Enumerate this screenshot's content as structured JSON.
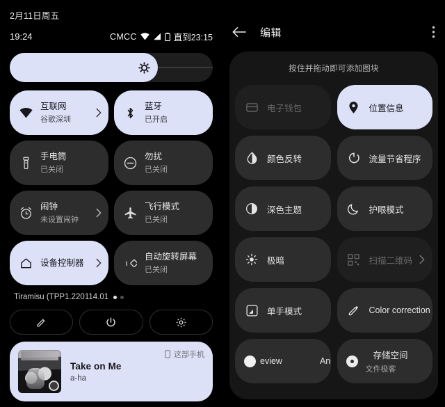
{
  "left_panel": {
    "date": "2月11日周五",
    "status": {
      "clock": "19:24",
      "carrier": "CMCC",
      "wifi_icon": "wifi-icon",
      "signal_icon": "cellular-signal-icon",
      "battery_icon": "battery-icon",
      "battery_text": "直到23:15"
    },
    "brightness": {
      "icon": "brightness-icon",
      "level_percent": 73
    },
    "tiles": [
      {
        "title": "互联网",
        "subtitle": "谷歌深圳",
        "icon": "wifi-icon",
        "active": true,
        "chevron": true
      },
      {
        "title": "蓝牙",
        "subtitle": "已开启",
        "icon": "bluetooth-icon",
        "active": true,
        "chevron": false
      },
      {
        "title": "手电筒",
        "subtitle": "已关闭",
        "icon": "flashlight-icon",
        "active": false,
        "chevron": false
      },
      {
        "title": "勿扰",
        "subtitle": "已关闭",
        "icon": "do-not-disturb-icon",
        "active": false,
        "chevron": false
      },
      {
        "title": "闹钟",
        "subtitle": "未设置闹钟",
        "icon": "alarm-icon",
        "active": false,
        "chevron": true
      },
      {
        "title": "飞行模式",
        "subtitle": "已关闭",
        "icon": "airplane-icon",
        "active": false,
        "chevron": false
      },
      {
        "title": "设备控制器",
        "subtitle": "",
        "icon": "home-icon",
        "active": true,
        "chevron": true
      },
      {
        "title": "自动旋转屏幕",
        "subtitle": "已关闭",
        "icon": "auto-rotate-icon",
        "active": false,
        "chevron": false
      }
    ],
    "build": "Tiramisu (TPP1.220114.01",
    "pager": {
      "pages": 2,
      "current": 1
    },
    "actions": [
      {
        "name": "edit-button",
        "icon": "pencil-icon"
      },
      {
        "name": "power-button",
        "icon": "power-icon"
      },
      {
        "name": "settings-button",
        "icon": "gear-icon"
      }
    ],
    "media": {
      "title": "Take on Me",
      "artist": "a-ha",
      "device": "这部手机",
      "device_icon": "phone-icon",
      "album_art": "album-art"
    }
  },
  "right_panel": {
    "header": {
      "back_icon": "back-arrow-icon",
      "title": "编辑",
      "overflow_icon": "overflow-menu-icon"
    },
    "hint": "按住并拖动即可添加图块",
    "tiles": [
      {
        "label": "电子钱包",
        "sub": "",
        "icon": "wallet-icon",
        "state": "dim",
        "chevron": false
      },
      {
        "label": "位置信息",
        "sub": "",
        "icon": "location-pin-icon",
        "state": "active",
        "chevron": false
      },
      {
        "label": "颜色反转",
        "sub": "",
        "icon": "color-invert-icon",
        "state": "normal",
        "chevron": false
      },
      {
        "label": "流量节省程序",
        "sub": "",
        "icon": "data-saver-icon",
        "state": "normal",
        "chevron": false
      },
      {
        "label": "深色主题",
        "sub": "",
        "icon": "dark-theme-icon",
        "state": "normal",
        "chevron": false
      },
      {
        "label": "护眼模式",
        "sub": "",
        "icon": "night-light-moon-icon",
        "state": "normal",
        "chevron": false
      },
      {
        "label": "极暗",
        "sub": "",
        "icon": "extra-dim-icon",
        "state": "normal",
        "chevron": false
      },
      {
        "label": "扫描二维码",
        "sub": "",
        "icon": "qr-scan-icon",
        "state": "dim",
        "chevron": true
      },
      {
        "label": "单手模式",
        "sub": "",
        "icon": "one-handed-icon",
        "state": "normal",
        "chevron": false
      },
      {
        "label": "Color correction",
        "sub": "",
        "icon": "color-correction-icon",
        "state": "normal",
        "chevron": false
      }
    ],
    "bottom_tiles": {
      "marquee": {
        "text_left": "eview",
        "text_right": "Android",
        "icon": "circle-icon"
      },
      "storage": {
        "label": "存储空间",
        "sub": "文件极客",
        "icon": "storage-dot-icon"
      }
    }
  },
  "colors": {
    "accent_active": "#dde1f7",
    "tile_inactive": "#2d2d2d",
    "panel_bg": "#000000",
    "edit_panel_bg": "#161616"
  }
}
